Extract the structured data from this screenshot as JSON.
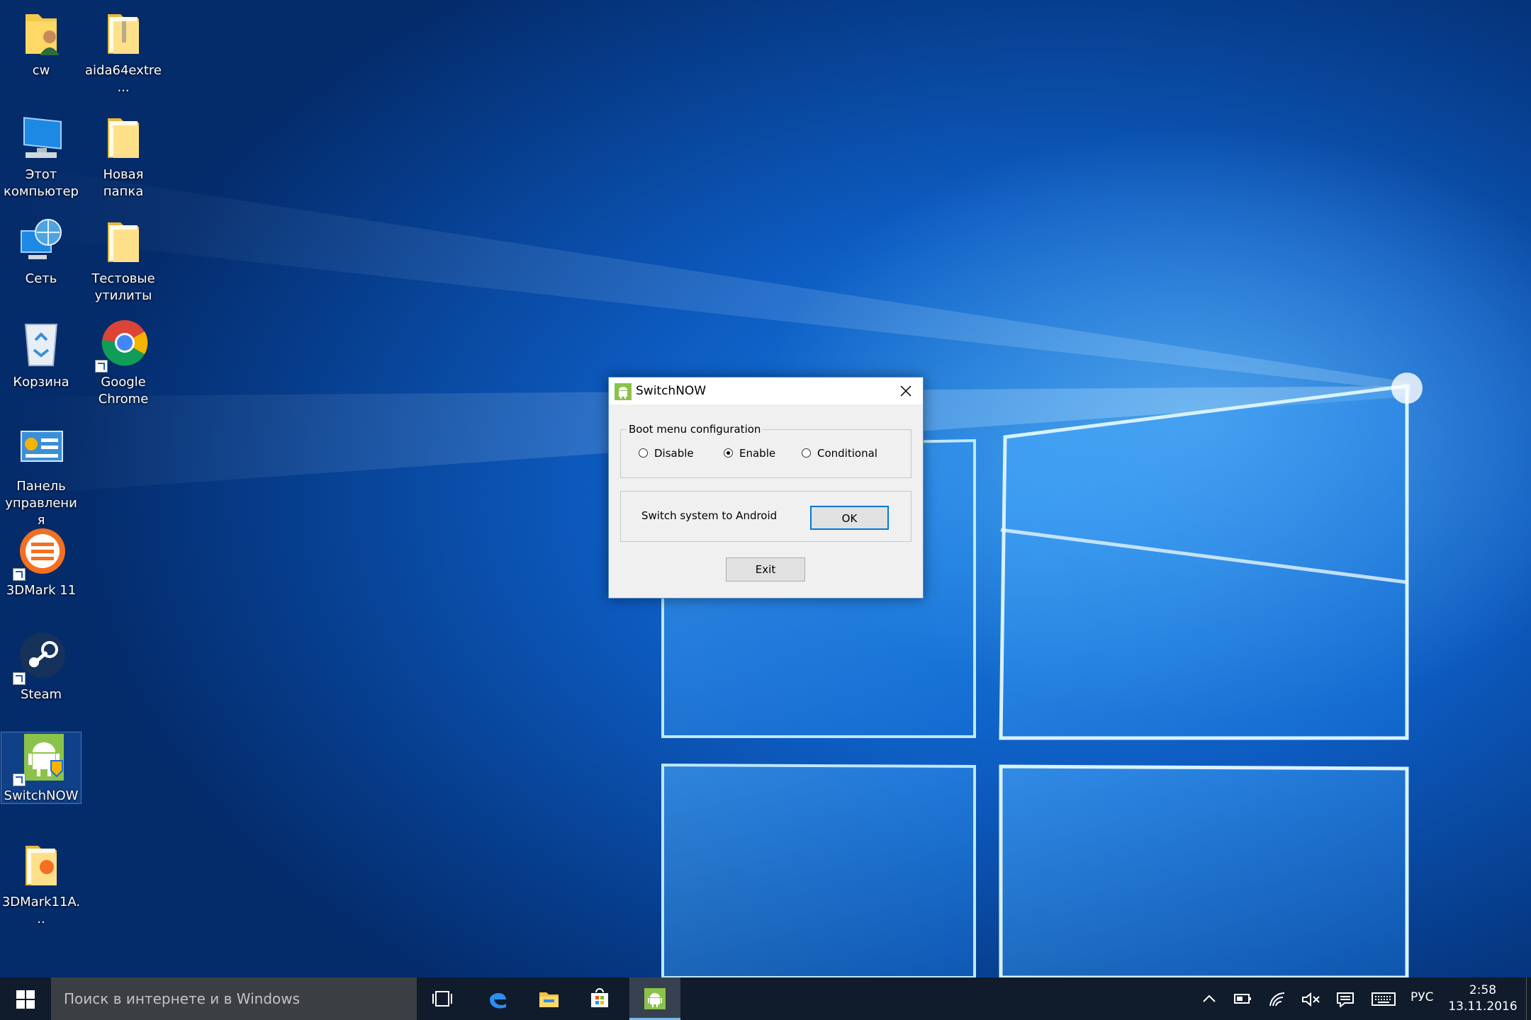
{
  "desktop": {
    "icons": [
      {
        "label": "cw"
      },
      {
        "label": "aida64extre..."
      },
      {
        "label": "Этот компьютер"
      },
      {
        "label": "Новая папка"
      },
      {
        "label": "Сеть"
      },
      {
        "label": "Тестовые утилиты"
      },
      {
        "label": "Корзина"
      },
      {
        "label": "Google Chrome"
      },
      {
        "label": "Панель управления"
      },
      {
        "label": "3DMark 11"
      },
      {
        "label": "Steam"
      },
      {
        "label": "SwitchNOW"
      },
      {
        "label": "3DMark11A..."
      }
    ]
  },
  "dialog": {
    "title": "SwitchNOW",
    "boot_group_label": "Boot menu configuration",
    "radio_options": [
      {
        "label": "Disable",
        "selected": false
      },
      {
        "label": "Enable",
        "selected": true
      },
      {
        "label": "Conditional",
        "selected": false
      }
    ],
    "switch_label": "Switch system to Android",
    "ok_label": "OK",
    "exit_label": "Exit"
  },
  "taskbar": {
    "search_placeholder": "Поиск в интернете и в Windows",
    "apps": [
      "task-view",
      "edge",
      "file-explorer",
      "store",
      "switchnow"
    ],
    "language": "РУС",
    "time": "2:58",
    "date": "13.11.2016"
  },
  "colors": {
    "taskbar": "#101b2b",
    "accent": "#0078d7",
    "android_green": "#8bc34a"
  }
}
